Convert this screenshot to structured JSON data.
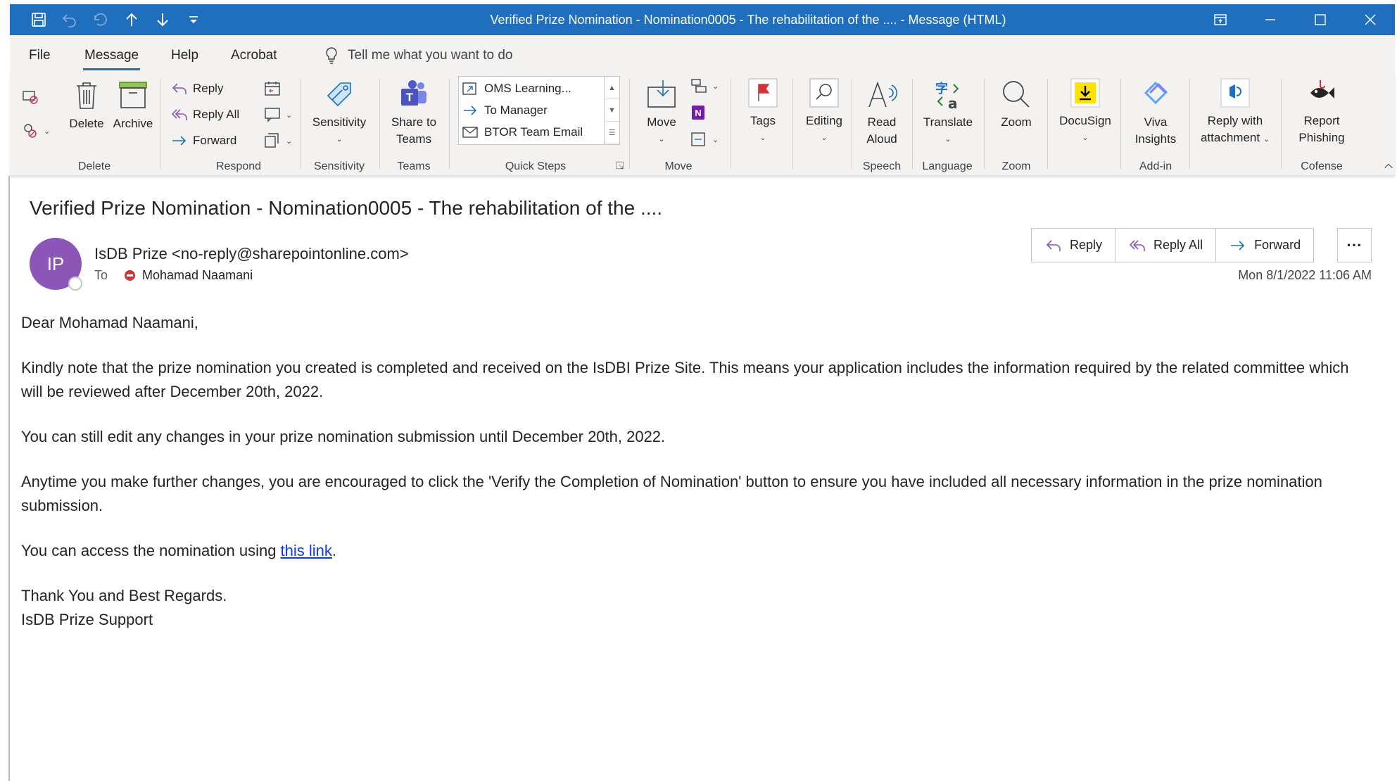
{
  "window": {
    "title": "Verified Prize Nomination - Nomination0005 - The rehabilitation of the ....  -  Message (HTML)",
    "accent_color": "#1f6fbe"
  },
  "menu": {
    "tabs": [
      "File",
      "Message",
      "Help",
      "Acrobat"
    ],
    "active_tab": "Message",
    "tell_me": "Tell me what you want to do"
  },
  "ribbon": {
    "delete_group": {
      "label": "Delete",
      "delete": "Delete",
      "archive": "Archive"
    },
    "respond_group": {
      "label": "Respond",
      "reply": "Reply",
      "reply_all": "Reply All",
      "forward": "Forward"
    },
    "sensitivity_group": {
      "label": "Sensitivity",
      "sensitivity": "Sensitivity"
    },
    "teams_group": {
      "label": "Teams",
      "share_line1": "Share to",
      "share_line2": "Teams"
    },
    "quicksteps_group": {
      "label": "Quick Steps",
      "items": [
        "OMS Learning...",
        "To Manager",
        "BTOR Team Email"
      ]
    },
    "move_group": {
      "label": "Move",
      "move": "Move"
    },
    "tags": "Tags",
    "editing": "Editing",
    "speech_group": {
      "label": "Speech",
      "read_line1": "Read",
      "read_line2": "Aloud"
    },
    "language_group": {
      "label": "Language",
      "translate": "Translate"
    },
    "zoom_group": {
      "label": "Zoom",
      "zoom": "Zoom"
    },
    "docusign": "DocuSign",
    "addin_group": {
      "label": "Add-in",
      "viva_line1": "Viva",
      "viva_line2": "Insights"
    },
    "reply_attach": {
      "line1": "Reply with",
      "line2": "attachment"
    },
    "cofense_group": {
      "label": "Cofense",
      "report_line1": "Report",
      "report_line2": "Phishing"
    }
  },
  "message": {
    "subject": "Verified Prize Nomination - Nomination0005 - The rehabilitation of the ....",
    "avatar_initials": "IP",
    "avatar_color": "#8b56b8",
    "sender": "IsDB Prize <no-reply@sharepointonline.com>",
    "to_label": "To",
    "recipient": "Mohamad Naamani",
    "actions": {
      "reply": "Reply",
      "reply_all": "Reply All",
      "forward": "Forward",
      "more": "···"
    },
    "datetime": "Mon 8/1/2022 11:06 AM"
  },
  "body": {
    "greeting": "Dear Mohamad Naamani,",
    "p1": "Kindly note that the prize nomination you created is completed and received on the IsDBI Prize Site. This means your application includes the information required by the related committee which will be reviewed after December 20th, 2022.",
    "p2": "You can still edit any changes in your prize nomination submission until December 20th, 2022.",
    "p3": "Anytime you make further changes, you are encouraged to click the 'Verify the Completion of Nomination' button to ensure you have included all necessary information in the prize nomination submission.",
    "p4_prefix": "You can access the nomination using ",
    "p4_link": "this link",
    "p4_suffix": ".",
    "closing1": "Thank You and Best Regards.",
    "closing2": "IsDB Prize Support"
  }
}
